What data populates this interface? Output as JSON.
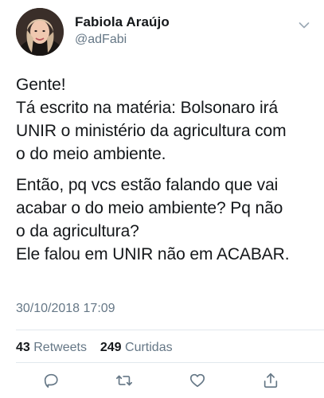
{
  "tweet": {
    "author_name": "Fabiola Araújo",
    "author_handle": "@adFabi",
    "text_lines_1": [
      "Gente!",
      "Tá escrito na matéria: Bolsonaro irá",
      "UNIR o ministério da agricultura com",
      "o do meio ambiente."
    ],
    "text_lines_2": [
      "Então, pq vcs estão falando que vai",
      "acabar o do meio ambiente? Pq não",
      "o da agricultura?",
      "Ele falou em UNIR não em ACABAR."
    ],
    "timestamp": "30/10/2018 17:09",
    "retweets_count": "43",
    "retweets_label": "Retweets",
    "likes_count": "249",
    "likes_label": "Curtidas"
  },
  "icons": {
    "menu": "chevron-down-icon",
    "reply": "reply-icon",
    "retweet": "retweet-icon",
    "like": "heart-icon",
    "share": "share-icon"
  },
  "colors": {
    "text": "#14171a",
    "secondary": "#657786",
    "divider": "#e1e8ed"
  }
}
